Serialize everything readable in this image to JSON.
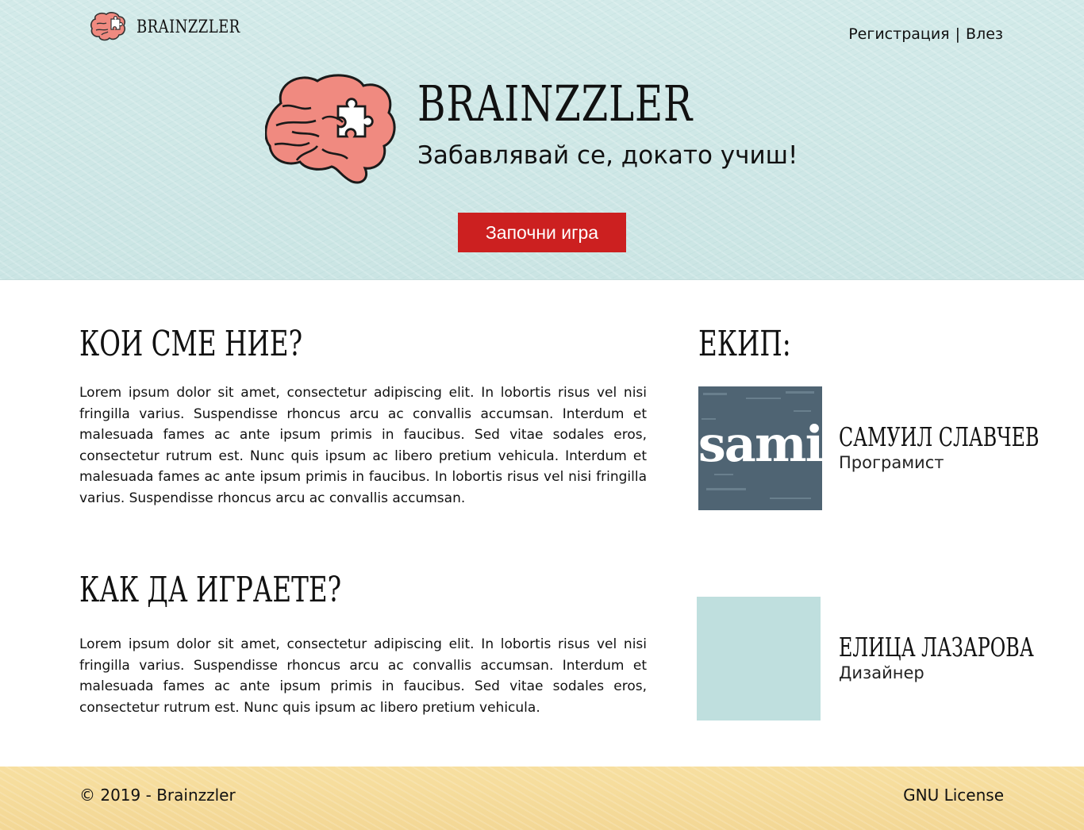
{
  "header": {
    "logo_text": "BRAINZZLER",
    "register_link": "Регистрация",
    "separator": "|",
    "login_link": "Влез"
  },
  "hero": {
    "title": "BRAINZZLER",
    "tagline": "Забавлявай се, докато учиш!",
    "start_button": "Започни игра"
  },
  "about": {
    "title": "КОИ СМЕ НИЕ?",
    "text": "Lorem ipsum dolor sit amet, consectetur adipiscing elit. In lobortis risus vel nisi fringilla varius. Suspendisse rhoncus arcu ac convallis accumsan. Interdum et malesuada fames ac ante ipsum primis in faucibus. Sed vitae sodales eros, consectetur rutrum est. Nunc quis ipsum ac libero pretium vehicula. Interdum et malesuada fames ac ante ipsum primis in faucibus. In lobortis risus vel nisi fringilla varius. Suspendisse rhoncus arcu ac convallis accumsan."
  },
  "howto": {
    "title": "КАК ДА ИГРАЕТЕ?",
    "text": "Lorem ipsum dolor sit amet, consectetur adipiscing elit. In lobortis risus vel nisi fringilla varius. Suspendisse rhoncus arcu ac convallis accumsan. Interdum et malesuada fames ac ante ipsum primis in faucibus. Sed vitae sodales eros, consectetur rutrum est. Nunc quis ipsum ac libero pretium vehicula."
  },
  "team": {
    "title": "ЕКИП:",
    "members": [
      {
        "name": "САМУИЛ СЛАВЧЕВ",
        "role": "Програмист",
        "avatar_text": "sami",
        "avatar_color": "#4f6473"
      },
      {
        "name": "ЕЛИЦА ЛАЗАРОВА",
        "role": "Дизайнер",
        "avatar_color": "#bfdfde"
      }
    ]
  },
  "footer": {
    "copyright": "© 2019 - Brainzzler",
    "license": "GNU License"
  },
  "colors": {
    "hero_bg": "#cfe7e6",
    "brain_pink": "#f08a80",
    "accent_red": "#cc2020",
    "footer_bg": "#f6dd9c"
  }
}
